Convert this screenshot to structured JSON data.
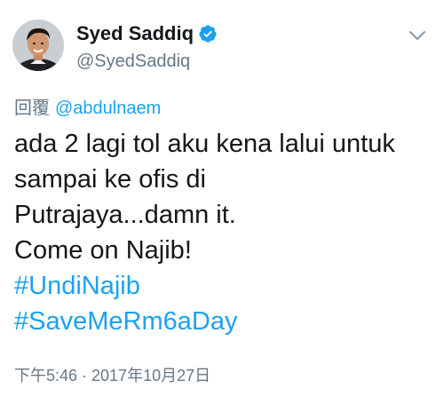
{
  "author": {
    "display_name": "Syed Saddiq",
    "handle": "@SyedSaddiq",
    "verified": true,
    "avatar_icon": "profile-photo"
  },
  "reply": {
    "prefix": "回覆",
    "user": "@abdulnaem"
  },
  "tweet_lines": [
    "ada 2 lagi tol aku kena lalui untuk",
    "sampai ke ofis di",
    "Putrajaya...damn it.",
    "Come on Najib!"
  ],
  "hashtags": [
    "#UndiNajib",
    "#SaveMeRm6aDay"
  ],
  "timestamp": "下午5:46 · 2017年10月27日",
  "colors": {
    "link": "#1da1f2",
    "secondary_text": "#657786",
    "primary_text": "#14171a",
    "verified_badge": "#1da1f2"
  },
  "icons": {
    "verified": "verified-badge-icon",
    "menu": "chevron-down-icon"
  }
}
